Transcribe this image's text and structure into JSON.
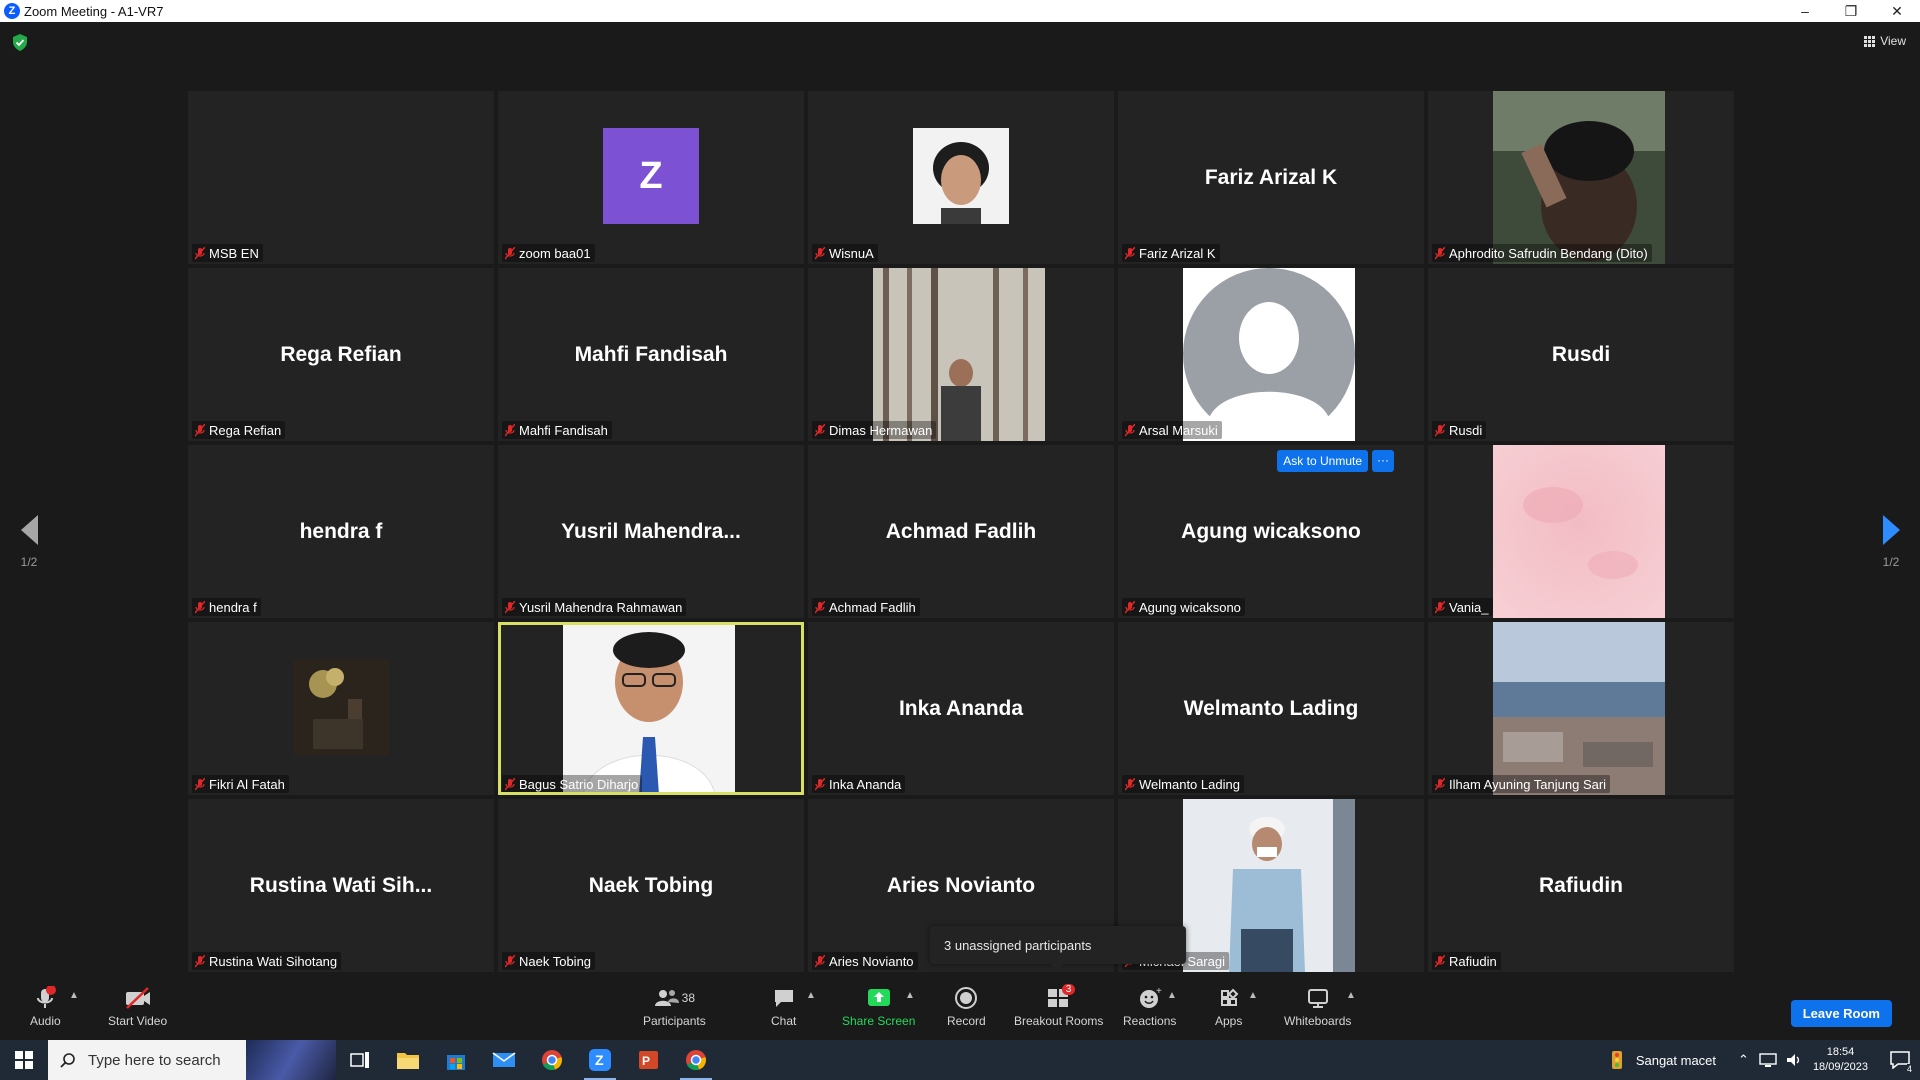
{
  "window": {
    "title": "Zoom Meeting - A1-VR7"
  },
  "top": {
    "view_label": "View"
  },
  "paging": {
    "left_page": "1/2",
    "right_page": "1/2"
  },
  "tiles": [
    {
      "label": "MSB EN",
      "big": ""
    },
    {
      "label": "zoom baa01",
      "big": "",
      "avatar_letter": "Z"
    },
    {
      "label": "WisnuA",
      "big": ""
    },
    {
      "label": "Fariz Arizal K",
      "big": "Fariz Arizal K"
    },
    {
      "label": "Aphrodito Safrudin Bendang (Dito)",
      "big": ""
    },
    {
      "label": "Rega Refian",
      "big": "Rega Refian"
    },
    {
      "label": "Mahfi Fandisah",
      "big": "Mahfi Fandisah"
    },
    {
      "label": "Dimas Hermawan",
      "big": ""
    },
    {
      "label": "Arsal Marsuki",
      "big": ""
    },
    {
      "label": "Rusdi",
      "big": "Rusdi"
    },
    {
      "label": "hendra f",
      "big": "hendra f"
    },
    {
      "label": "Yusril Mahendra Rahmawan",
      "big": "Yusril  Mahendra..."
    },
    {
      "label": "Achmad Fadlih",
      "big": "Achmad Fadlih"
    },
    {
      "label": "Agung wicaksono",
      "big": "Agung wicaksono"
    },
    {
      "label": "Vania_",
      "big": ""
    },
    {
      "label": "Fikri Al Fatah",
      "big": ""
    },
    {
      "label": "Bagus Satrio Diharjo",
      "big": ""
    },
    {
      "label": "Inka Ananda",
      "big": "Inka Ananda"
    },
    {
      "label": "Welmanto Lading",
      "big": "Welmanto Lading"
    },
    {
      "label": "Ilham Ayuning Tanjung Sari",
      "big": ""
    },
    {
      "label": "Rustina Wati Sihotang",
      "big": "Rustina  Wati Sih..."
    },
    {
      "label": "Naek Tobing",
      "big": "Naek Tobing"
    },
    {
      "label": "Aries Novianto",
      "big": "Aries Novianto"
    },
    {
      "label": "Michael Saragi",
      "big": ""
    },
    {
      "label": "Rafiudin",
      "big": "Rafiudin"
    }
  ],
  "hover": {
    "ask_unmute": "Ask to Unmute",
    "more": "···"
  },
  "tooltip": {
    "text": "3 unassigned participants"
  },
  "toolbar": {
    "audio": "Audio",
    "audio_badge": "!",
    "start_video": "Start Video",
    "participants": "Participants",
    "participants_count": "38",
    "chat": "Chat",
    "share_screen": "Share Screen",
    "record": "Record",
    "breakout_rooms": "Breakout Rooms",
    "breakout_badge": "3",
    "reactions": "Reactions",
    "apps": "Apps",
    "whiteboards": "Whiteboards",
    "leave": "Leave Room"
  },
  "taskbar": {
    "search_placeholder": "Type here to search",
    "weather": "Sangat macet",
    "time": "18:54",
    "date": "18/09/2023",
    "notif_count": "4"
  },
  "colors": {
    "accent_blue": "#0e72ed",
    "share_green": "#23d959",
    "active_speaker": "#d7e062",
    "mute_red": "#e02828"
  }
}
